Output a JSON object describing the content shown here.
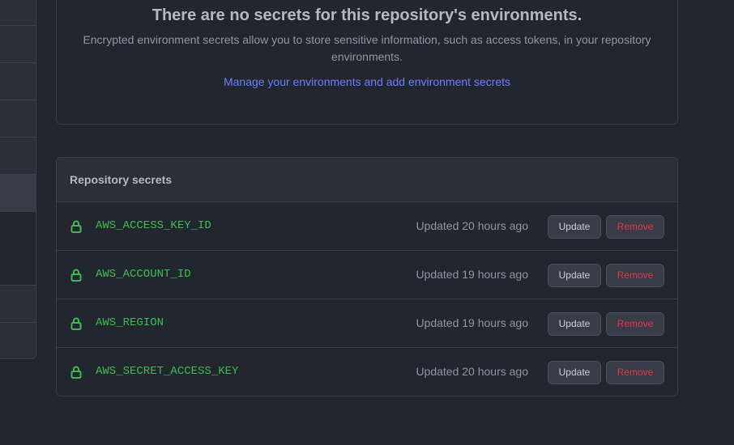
{
  "sidebar": {
    "items": [
      "",
      "",
      "",
      "",
      "",
      "",
      ""
    ],
    "selected_index": 4
  },
  "environments": {
    "empty_title": "There are no secrets for this repository's environments.",
    "empty_description": "Encrypted environment secrets allow you to store sensitive information, such as access tokens, in your repository environments.",
    "manage_link": "Manage your environments and add environment secrets"
  },
  "repository_secrets": {
    "header": "Repository secrets",
    "rows": [
      {
        "name": "AWS_ACCESS_KEY_ID",
        "updated": "Updated 20 hours ago",
        "update_label": "Update",
        "remove_label": "Remove",
        "icon": "lock-icon"
      },
      {
        "name": "AWS_ACCOUNT_ID",
        "updated": "Updated 19 hours ago",
        "update_label": "Update",
        "remove_label": "Remove",
        "icon": "lock-icon"
      },
      {
        "name": "AWS_REGION",
        "updated": "Updated 19 hours ago",
        "update_label": "Update",
        "remove_label": "Remove",
        "icon": "lock-icon"
      },
      {
        "name": "AWS_SECRET_ACCESS_KEY",
        "updated": "Updated 20 hours ago",
        "update_label": "Update",
        "remove_label": "Remove",
        "icon": "lock-icon"
      }
    ]
  },
  "colors": {
    "background": "#22262e",
    "secret_name": "#3fb950",
    "link": "#6f7cf6",
    "danger": "#e5364e"
  }
}
